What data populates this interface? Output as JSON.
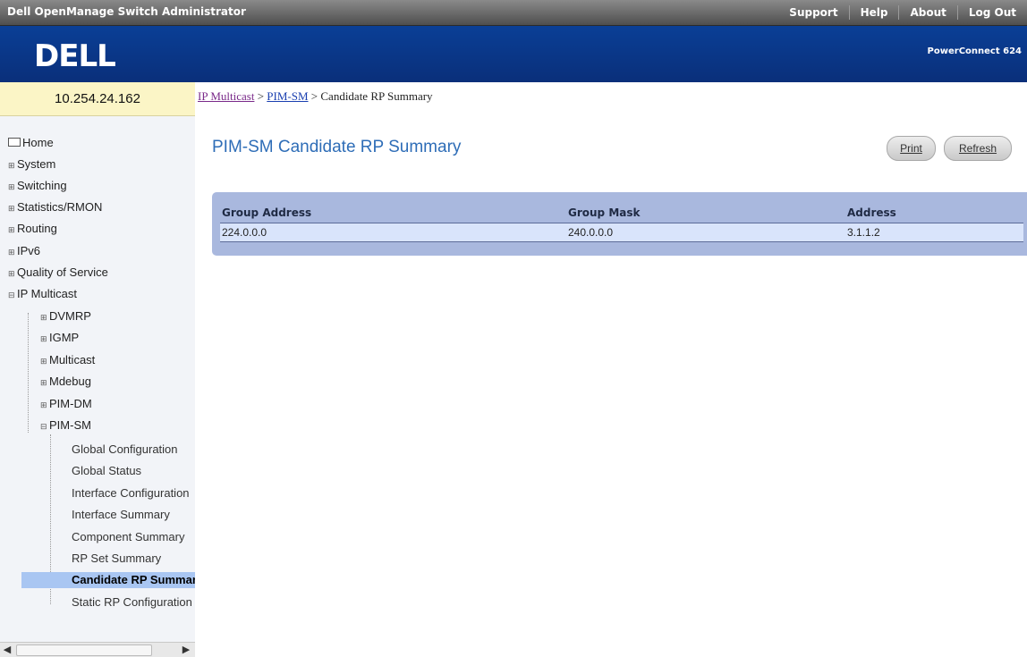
{
  "topbar": {
    "app_title": "Dell OpenManage Switch Administrator",
    "links": [
      "Support",
      "Help",
      "About",
      "Log Out"
    ]
  },
  "banner": {
    "logo": "DELL",
    "product": "PowerConnect 624"
  },
  "sidebar": {
    "ip": "10.254.24.162",
    "items": [
      {
        "label": "Home"
      },
      {
        "label": "System"
      },
      {
        "label": "Switching"
      },
      {
        "label": "Statistics/RMON"
      },
      {
        "label": "Routing"
      },
      {
        "label": "IPv6"
      },
      {
        "label": "Quality of Service"
      },
      {
        "label": "IP Multicast"
      },
      {
        "label": "DVMRP"
      },
      {
        "label": "IGMP"
      },
      {
        "label": "Multicast"
      },
      {
        "label": "Mdebug"
      },
      {
        "label": "PIM-DM"
      },
      {
        "label": "PIM-SM"
      },
      {
        "label": "Global Configuration"
      },
      {
        "label": "Global Status"
      },
      {
        "label": "Interface Configuration"
      },
      {
        "label": "Interface Summary"
      },
      {
        "label": "Component Summary"
      },
      {
        "label": "RP Set Summary"
      },
      {
        "label": "Candidate RP Summary"
      },
      {
        "label": "Static RP Configuration"
      }
    ]
  },
  "breadcrumb": {
    "crumb1": "IP Multicast",
    "sep": ">",
    "crumb2": "PIM-SM",
    "current": "Candidate RP Summary"
  },
  "main": {
    "title": "PIM-SM Candidate RP Summary",
    "print_label": "Print",
    "refresh_label": "Refresh",
    "table": {
      "headers": [
        "Group Address",
        "Group Mask",
        "Address"
      ],
      "rows": [
        [
          "224.0.0.0",
          "240.0.0.0",
          "3.1.1.2"
        ]
      ]
    }
  },
  "colors": {
    "banner": "#0a2f7a",
    "title": "#2e6db7",
    "panel": "#a9b8de",
    "row": "#d9e4fb",
    "selected": "#a9c6f2"
  }
}
